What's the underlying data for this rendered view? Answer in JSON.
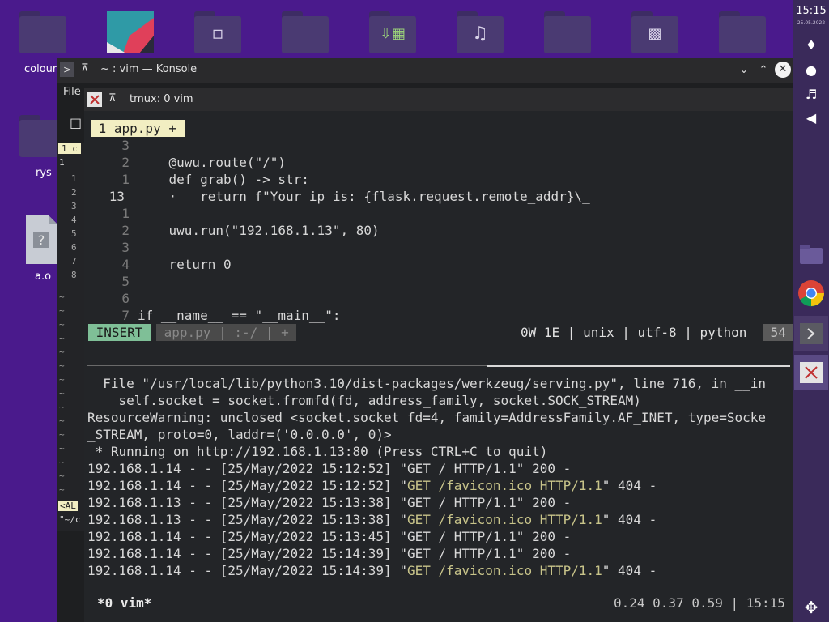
{
  "desktop": {
    "icon_labels": {
      "colour": "colour",
      "rys": "rys",
      "ao": "a.o"
    }
  },
  "panel": {
    "clock": "15:15",
    "date": "25.05.2022"
  },
  "konsole": {
    "title": "~ : vim — Konsole",
    "menu_file": "File",
    "bg_tab": "1 c",
    "bg_first_line": "1",
    "bg_line_numbers": [
      "1",
      "2",
      "3",
      "4",
      "5",
      "6",
      "7",
      "8"
    ],
    "bg_mode": "<AL",
    "bg_cmd": "\"~/c"
  },
  "tmux": {
    "title": "tmux: 0 vim",
    "tab": " 1 app.py + ",
    "code_lines": [
      {
        "num": "3",
        "text": ""
      },
      {
        "num": "2",
        "text": "    @uwu.route(\"/\")"
      },
      {
        "num": "1",
        "text": "    def grab() -> str:"
      },
      {
        "num": "13",
        "text": "    ·   return f\"Your ip is: {flask.request.remote_addr}\\_"
      },
      {
        "num": "1",
        "text": ""
      },
      {
        "num": "2",
        "text": "    uwu.run(\"192.168.1.13\", 80)"
      },
      {
        "num": "3",
        "text": ""
      },
      {
        "num": "4",
        "text": "    return 0"
      },
      {
        "num": "5",
        "text": ""
      },
      {
        "num": "6",
        "text": ""
      },
      {
        "num": "7",
        "text": "if __name__ == \"__main__\":"
      }
    ],
    "status": {
      "mode": " INSERT ",
      "file": " app.py | :-/ | + ",
      "right": "0W 1E | unix | utf-8 | python ",
      "percent": " 54"
    },
    "log": [
      {
        "a": "  File \"/usr/local/lib/python3.10/dist-packages/werkzeug/serving.py\", line 716, in __in",
        "y": "",
        "b": ""
      },
      {
        "a": "    self.socket = socket.fromfd(fd, address_family, socket.SOCK_STREAM)",
        "y": "",
        "b": ""
      },
      {
        "a": "ResourceWarning: unclosed <socket.socket fd=4, family=AddressFamily.AF_INET, type=Socke",
        "y": "",
        "b": ""
      },
      {
        "a": "_STREAM, proto=0, laddr=('0.0.0.0', 0)>",
        "y": "",
        "b": ""
      },
      {
        "a": " * Running on http://192.168.1.13:80 (Press CTRL+C to quit)",
        "y": "",
        "b": ""
      },
      {
        "a": "192.168.1.14 - - [25/May/2022 15:12:52] \"GET / HTTP/1.1\" 200 -",
        "y": "",
        "b": ""
      },
      {
        "a": "192.168.1.14 - - [25/May/2022 15:12:52] \"",
        "y": "GET /favicon.ico HTTP/1.1",
        "b": "\" 404 -"
      },
      {
        "a": "192.168.1.13 - - [25/May/2022 15:13:38] \"GET / HTTP/1.1\" 200 -",
        "y": "",
        "b": ""
      },
      {
        "a": "192.168.1.13 - - [25/May/2022 15:13:38] \"",
        "y": "GET /favicon.ico HTTP/1.1",
        "b": "\" 404 -"
      },
      {
        "a": "192.168.1.14 - - [25/May/2022 15:13:45] \"GET / HTTP/1.1\" 200 -",
        "y": "",
        "b": ""
      },
      {
        "a": "192.168.1.14 - - [25/May/2022 15:14:39] \"GET / HTTP/1.1\" 200 -",
        "y": "",
        "b": ""
      },
      {
        "a": "192.168.1.14 - - [25/May/2022 15:14:39] \"",
        "y": "GET /favicon.ico HTTP/1.1",
        "b": "\" 404 -"
      }
    ],
    "bottom": {
      "session": "*0 vim*",
      "load": "0.24 0.37 0.59 | 15:15"
    }
  },
  "colors": {
    "desktop_bg": "#4a1a8c",
    "tab_highlight": "#f2eec2",
    "insert_mode": "#7fbf97",
    "status_dark": "#5a5a5a",
    "log_yellow": "#c8c48a"
  }
}
